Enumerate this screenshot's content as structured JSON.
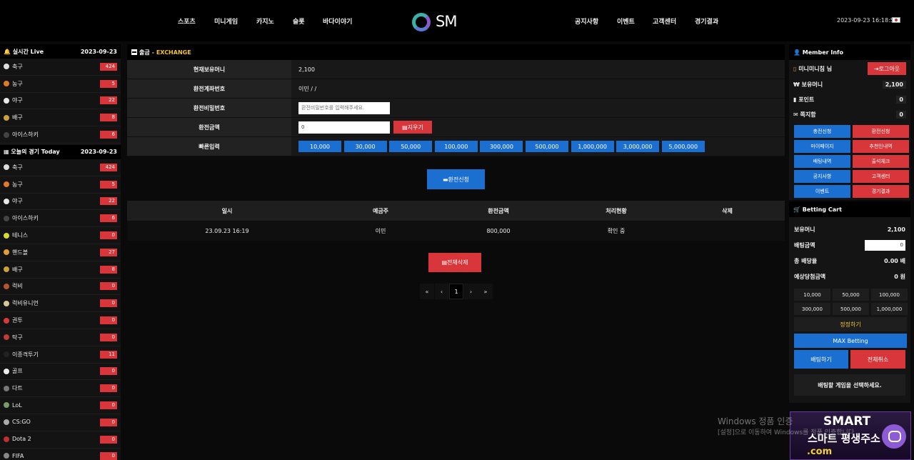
{
  "nav": {
    "left": [
      "스포츠",
      "미니게임",
      "카지노",
      "슬롯",
      "바다이야기"
    ],
    "right": [
      "공지사항",
      "이벤트",
      "고객센터",
      "경기결과"
    ],
    "logo_text": "SM",
    "datetime": "2023-09-23 16:18:51"
  },
  "live": {
    "title": "실시간 Live",
    "date": "2023-09-23",
    "items": [
      {
        "name": "축구",
        "count": "424",
        "icon_color": "#dddddd"
      },
      {
        "name": "농구",
        "count": "5",
        "icon_color": "#e07b26"
      },
      {
        "name": "야구",
        "count": "22",
        "icon_color": "#e8e8e8"
      },
      {
        "name": "배구",
        "count": "8",
        "icon_color": "#c9a23a"
      },
      {
        "name": "아이스하키",
        "count": "6",
        "icon_color": "#444444"
      }
    ]
  },
  "today": {
    "title": "오늘의 경기 Today",
    "date": "2023-09-23",
    "items": [
      {
        "name": "축구",
        "count": "424",
        "icon_color": "#dddddd"
      },
      {
        "name": "농구",
        "count": "5",
        "icon_color": "#e07b26"
      },
      {
        "name": "야구",
        "count": "22",
        "icon_color": "#e8e8e8"
      },
      {
        "name": "아이스하키",
        "count": "6",
        "icon_color": "#444444"
      },
      {
        "name": "테니스",
        "count": "0",
        "icon_color": "#d6dc32"
      },
      {
        "name": "핸드볼",
        "count": "27",
        "icon_color": "#e0a030"
      },
      {
        "name": "배구",
        "count": "8",
        "icon_color": "#c9a23a"
      },
      {
        "name": "럭비",
        "count": "0",
        "icon_color": "#b5542a"
      },
      {
        "name": "럭비유니언",
        "count": "0",
        "icon_color": "#d8c69a"
      },
      {
        "name": "권투",
        "count": "0",
        "icon_color": "#d83a3a"
      },
      {
        "name": "탁구",
        "count": "0",
        "icon_color": "#c03a3a"
      },
      {
        "name": "이종격투기",
        "count": "11",
        "icon_color": "#222222"
      },
      {
        "name": "골프",
        "count": "0",
        "icon_color": "#eeeeee"
      },
      {
        "name": "다트",
        "count": "0",
        "icon_color": "#777777"
      },
      {
        "name": "LoL",
        "count": "0",
        "icon_color": "#7a9a6a"
      },
      {
        "name": "CS:GO",
        "count": "0",
        "icon_color": "#aaaaaa"
      },
      {
        "name": "Dota 2",
        "count": "0",
        "icon_color": "#c03030"
      },
      {
        "name": "FIFA",
        "count": "0",
        "icon_color": "#888888"
      }
    ]
  },
  "exchange": {
    "section": "출금",
    "section_sub": "- EXCHANGE",
    "rows": {
      "balance_label": "현재보유머니",
      "balance_value": "2,100",
      "account_label": "환전계좌번호",
      "account_value": "이민 / /",
      "password_label": "환전비밀번호",
      "password_placeholder": "환전비밀번호를 입력해주세요.",
      "amount_label": "환전금액",
      "amount_value": "0",
      "clear_label": "지우기",
      "quick_label": "빠른입력"
    },
    "quick_amounts": [
      "10,000",
      "30,000",
      "50,000",
      "100,000",
      "300,000",
      "500,000",
      "1,000,000",
      "3,000,000",
      "5,000,000"
    ],
    "submit_label": "환전신청"
  },
  "history": {
    "headers": [
      "일시",
      "예금주",
      "환전금액",
      "처리현황",
      "삭제"
    ],
    "rows": [
      [
        "23.09.23 16:19",
        "이민",
        "800,000",
        "확인 중",
        ""
      ]
    ],
    "delete_all_label": "전체삭제"
  },
  "pager": {
    "first": "«",
    "prev": "‹",
    "current": "1",
    "next": "›",
    "last": "»"
  },
  "member": {
    "title": "Member Info",
    "nickname": "미니미니침 님",
    "logout_label": "로그아웃",
    "money_label": "보유머니",
    "money_value": "2,100",
    "point_label": "포인트",
    "point_value": "0",
    "message_label": "쪽지함",
    "message_value": "0",
    "menu": [
      {
        "label": "충전신청",
        "color": "blue"
      },
      {
        "label": "환전신청",
        "color": "red"
      },
      {
        "label": "마이페이지",
        "color": "blue"
      },
      {
        "label": "추천인내역",
        "color": "red"
      },
      {
        "label": "배팅내역",
        "color": "blue"
      },
      {
        "label": "출석체크",
        "color": "red"
      },
      {
        "label": "공지사항",
        "color": "blue"
      },
      {
        "label": "고객센터",
        "color": "red"
      },
      {
        "label": "이벤트",
        "color": "blue"
      },
      {
        "label": "경기결과",
        "color": "red"
      }
    ]
  },
  "cart": {
    "title": "Betting Cart",
    "money_label": "보유머니",
    "money_value": "2,100",
    "bet_label": "배팅금액",
    "bet_value": "0",
    "odds_label": "총 배당율",
    "odds_value": "0.00 배",
    "expected_label": "예상당첨금액",
    "expected_value": "0 원",
    "amounts": [
      "10,000",
      "50,000",
      "100,000",
      "300,000",
      "500,000",
      "1,000,000"
    ],
    "reset_label": "정정하기",
    "max_label": "MAX Betting",
    "bet_btn": "배팅하기",
    "cancel_btn": "전체취소",
    "notice": "배팅할 게임을 선택하세요."
  },
  "watermark": {
    "line1": "Windows 정품 인증",
    "line2": "[설정]으로 이동하여 Windows를 정품 인증합니다."
  },
  "promo": {
    "line1": "SMART",
    "line2": "스마트 평생주소",
    "line3": ".com"
  },
  "colors": {
    "accent_blue": "#1a6fd0",
    "accent_red": "#d8363a",
    "highlight_yellow": "#f1c232"
  }
}
